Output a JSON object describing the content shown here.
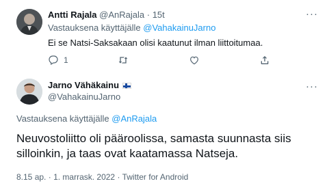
{
  "reply_tweet": {
    "author_name": "Antti Rajala",
    "author_handle": "@AnRajala",
    "separator": "·",
    "time": "15t",
    "replying_to_label": "Vastauksena käyttäjälle",
    "replying_to_handle": "@VahakainuJarno",
    "text": "Ei se Natsi-Saksakaan olisi kaatunut ilman liittoitumaa.",
    "reply_count": "1",
    "retweet_count": "",
    "like_count": "",
    "more_icon": "more-dots-icon"
  },
  "main_tweet": {
    "author_name": "Jarno Vähäkainu",
    "flag": "finland-flag-icon",
    "author_handle": "@VahakainuJarno",
    "replying_to_label": "Vastauksena käyttäjälle",
    "replying_to_handle": "@AnRajala",
    "text": "Neuvostoliitto oli pääroolissa, samasta  suunnasta siis silloinkin, ja taas ovat kaatamassa Natseja.",
    "time": "8.15 ap.",
    "separator": "·",
    "date": "1. marrask. 2022",
    "source": "Twitter for Android"
  },
  "colors": {
    "link": "#1d9bf0",
    "muted": "#536471",
    "text": "#0f1419"
  }
}
